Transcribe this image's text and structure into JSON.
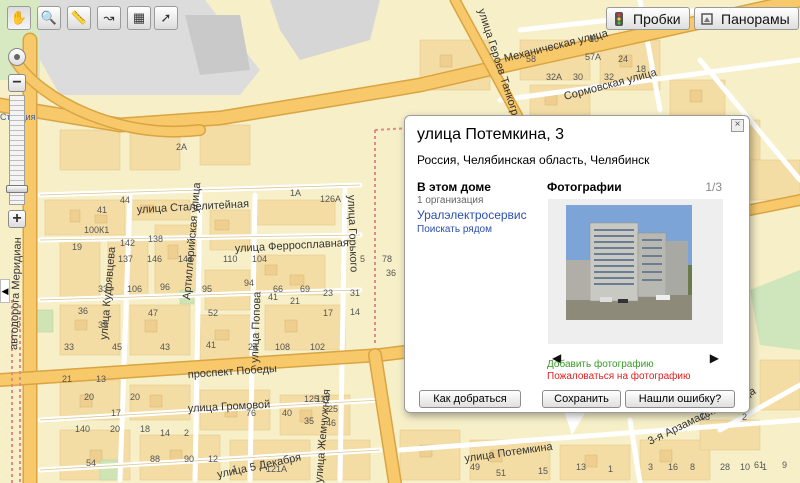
{
  "toolbar": {
    "tools": [
      {
        "icon": "hand-icon",
        "glyph": "✋"
      },
      {
        "icon": "zoom-area-icon",
        "glyph": "🔍"
      },
      {
        "icon": "ruler-icon",
        "glyph": "📏"
      },
      {
        "icon": "route-icon",
        "glyph": "↝"
      },
      {
        "icon": "map-layers-icon",
        "glyph": "▦"
      },
      {
        "icon": "info-pointer-icon",
        "glyph": "➚"
      }
    ],
    "traffic_label": "Пробки",
    "panorama_label": "Панорамы"
  },
  "zoom": {
    "plus": "+",
    "minus": "−",
    "level": 0.8
  },
  "map_labels": {
    "streets": [
      "Механическая улица",
      "улица Героев Танкограда",
      "Сормовская улица",
      "улица Сталелитейная",
      "Артиллерийская улица",
      "улица Ферросплавная",
      "улица Горького",
      "улица Кудрявцева",
      "улица Попова",
      "проспект Победы",
      "улица Громовой",
      "улица Жемчужная",
      "улица 5 Декабря",
      "улица Потемкина",
      "3-я Арзамасская улица",
      "автодорога Меридиан",
      "Станция"
    ],
    "houses": [
      "9",
      "58",
      "57А",
      "32А",
      "30",
      "32",
      "24",
      "18",
      "2А",
      "126А",
      "1А",
      "44",
      "41",
      "100К1",
      "142",
      "138",
      "19",
      "137",
      "146",
      "144",
      "110",
      "104",
      "5",
      "33",
      "106",
      "96",
      "95",
      "94",
      "66",
      "69",
      "23",
      "31",
      "36",
      "39",
      "47",
      "52",
      "41",
      "21",
      "17",
      "14",
      "33",
      "45",
      "43",
      "41",
      "24",
      "108",
      "102",
      "78",
      "21",
      "13",
      "20",
      "20",
      "17",
      "140",
      "20",
      "18",
      "14",
      "2",
      "76",
      "40",
      "35",
      "46",
      "54",
      "88",
      "90",
      "12",
      "1",
      "121А",
      "125",
      "117",
      "25",
      "36",
      "18",
      "2",
      "61",
      "9",
      "49",
      "51",
      "15",
      "13",
      "1",
      "3",
      "16",
      "8",
      "28",
      "10",
      "1",
      "10"
    ]
  },
  "popup": {
    "close": "×",
    "title": "улица Потемкина, 3",
    "address": "Россия, Челябинская область, Челябинск",
    "house_heading": "В этом доме",
    "org_count": "1 организация",
    "org_name": "Уралэлектросервис",
    "search_nearby": "Поискать рядом",
    "photos_heading": "Фотографии",
    "photo_counter": "1/3",
    "prev": "◀",
    "next": "▶",
    "add_photo": "Добавить фотографию",
    "report_photo": "Пожаловаться на фотографию",
    "btn_route": "Как добраться",
    "btn_save": "Сохранить",
    "btn_error": "Нашли ошибку?"
  },
  "colors": {
    "background": "#f6efc8",
    "major_road": "#f7c96b",
    "road_border": "#d9a441",
    "block": "#f3dda4",
    "link": "#2a4fb0",
    "add_photo": "#3a9a2a",
    "report_photo": "#e02020"
  }
}
